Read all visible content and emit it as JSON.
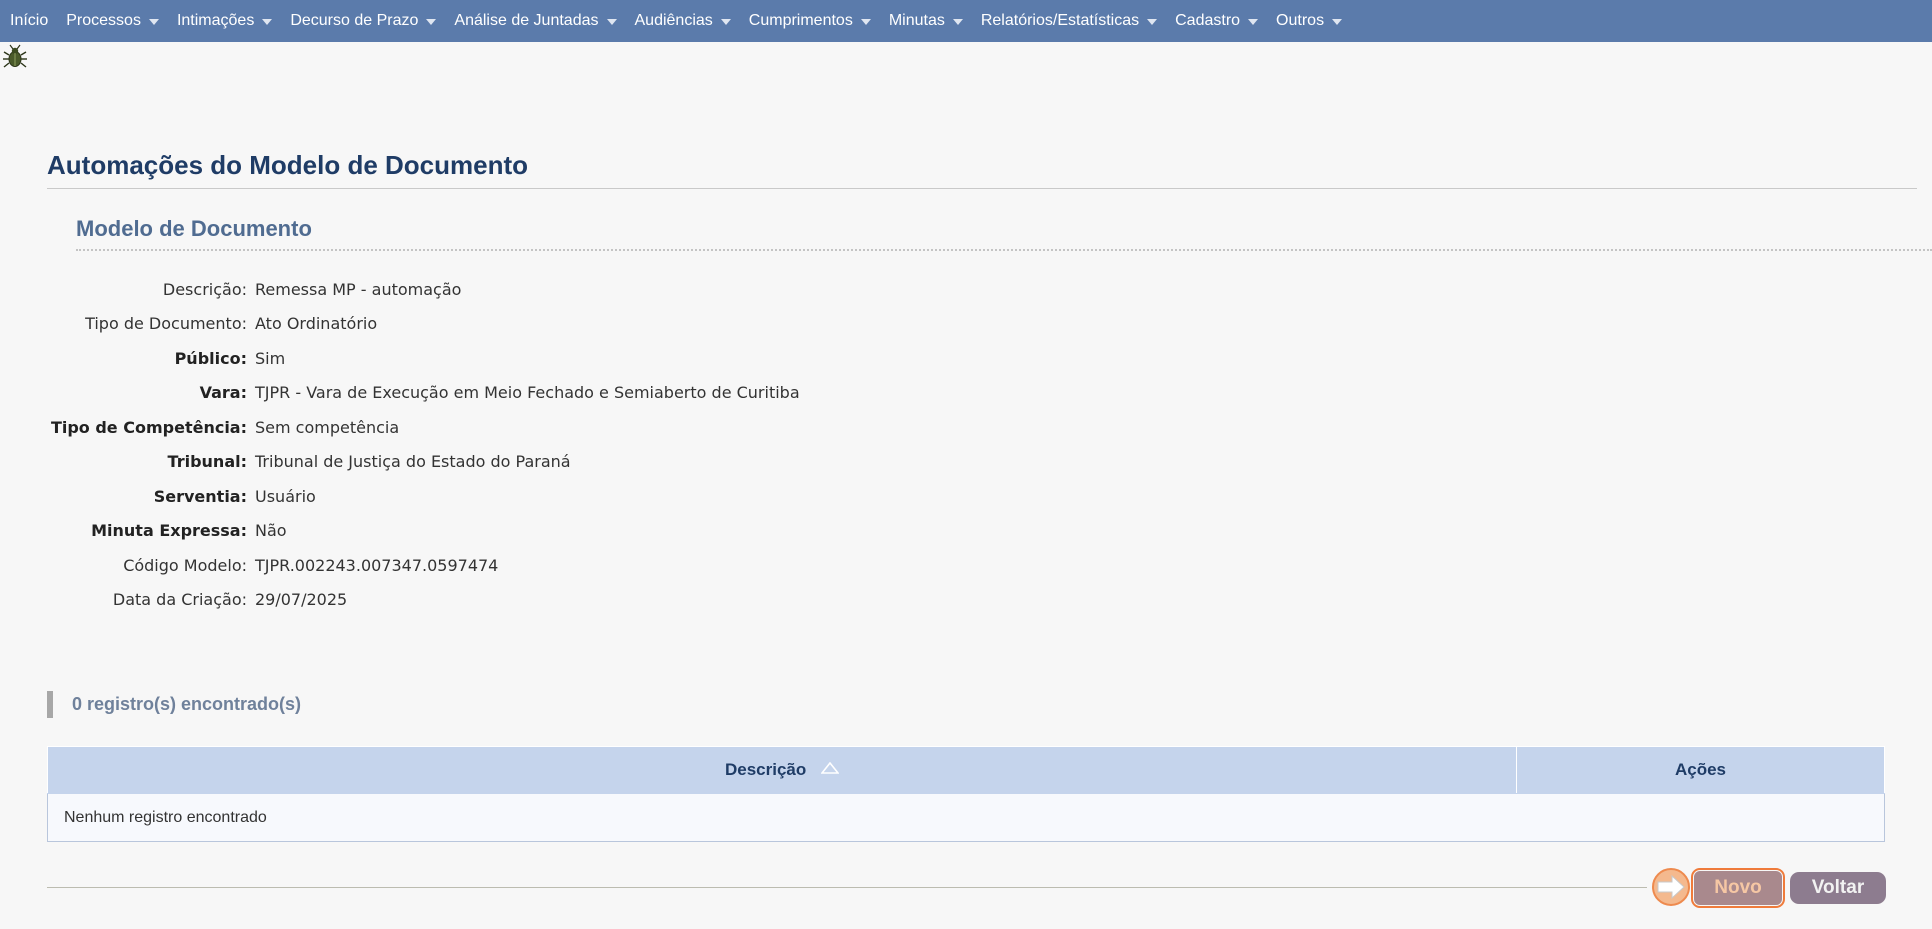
{
  "menu": {
    "items": [
      {
        "label": "Início",
        "has_caret": false
      },
      {
        "label": "Processos",
        "has_caret": true
      },
      {
        "label": "Intimações",
        "has_caret": true
      },
      {
        "label": "Decurso de Prazo",
        "has_caret": true
      },
      {
        "label": "Análise de Juntadas",
        "has_caret": true
      },
      {
        "label": "Audiências",
        "has_caret": true
      },
      {
        "label": "Cumprimentos",
        "has_caret": true
      },
      {
        "label": "Minutas",
        "has_caret": true
      },
      {
        "label": "Relatórios/Estatísticas",
        "has_caret": true
      },
      {
        "label": "Cadastro",
        "has_caret": true
      },
      {
        "label": "Outros",
        "has_caret": true
      }
    ],
    "background_color": "#5b7bab"
  },
  "page": {
    "title": "Automações do Modelo de Documento",
    "section_title": "Modelo de Documento"
  },
  "details": {
    "fields": [
      {
        "label": "Descrição:",
        "value": "Remessa MP - automação",
        "bold": false
      },
      {
        "label": "Tipo de Documento:",
        "value": "Ato Ordinatório",
        "bold": false
      },
      {
        "label": "Público:",
        "value": "Sim",
        "bold": true
      },
      {
        "label": "Vara:",
        "value": "TJPR - Vara de Execução em Meio Fechado e Semiaberto de Curitiba",
        "bold": true
      },
      {
        "label": "Tipo de Competência:",
        "value": "Sem competência",
        "bold": true
      },
      {
        "label": "Tribunal:",
        "value": "Tribunal de Justiça do Estado do Paraná",
        "bold": true
      },
      {
        "label": "Serventia:",
        "value": "Usuário",
        "bold": true
      },
      {
        "label": "Minuta Expressa:",
        "value": "Não",
        "bold": true
      },
      {
        "label": "Código Modelo:",
        "value": "TJPR.002243.007347.0597474",
        "bold": false
      },
      {
        "label": "Data da Criação:",
        "value": "29/07/2025",
        "bold": false
      }
    ]
  },
  "results": {
    "count_text": "0 registro(s) encontrado(s)",
    "columns": {
      "description": "Descrição",
      "actions": "Ações"
    },
    "empty_message": "Nenhum registro encontrado"
  },
  "footer": {
    "novo_label": "Novo",
    "voltar_label": "Voltar"
  },
  "icons": {
    "bug": "bug-icon",
    "sort": "sort-ascending-icon",
    "hint": "arrow-right-hint-icon"
  }
}
